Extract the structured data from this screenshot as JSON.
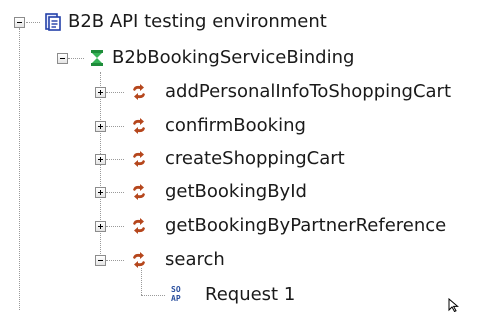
{
  "tree": {
    "root": {
      "label": "B2B API testing environment",
      "icon": "project-icon",
      "expanded": true
    },
    "binding": {
      "label": "B2bBookingServiceBinding",
      "icon": "interface-binding-icon",
      "expanded": true
    },
    "operations": [
      {
        "label": "addPersonalInfoToShoppingCart",
        "icon": "operation-icon",
        "expanded": false
      },
      {
        "label": "confirmBooking",
        "icon": "operation-icon",
        "expanded": false
      },
      {
        "label": "createShoppingCart",
        "icon": "operation-icon",
        "expanded": false
      },
      {
        "label": "getBookingById",
        "icon": "operation-icon",
        "expanded": false
      },
      {
        "label": "getBookingByPartnerReference",
        "icon": "operation-icon",
        "expanded": false
      },
      {
        "label": "search",
        "icon": "operation-icon",
        "expanded": true
      }
    ],
    "request": {
      "label": "Request 1",
      "icon": "soap-request-icon"
    }
  },
  "colors": {
    "tree_line": "#9a9a9a",
    "operation_icon": "#b5461c",
    "binding_icon": "#1e8c3a",
    "project_icon": "#2340a8",
    "request_icon": "#2a4f9e"
  }
}
